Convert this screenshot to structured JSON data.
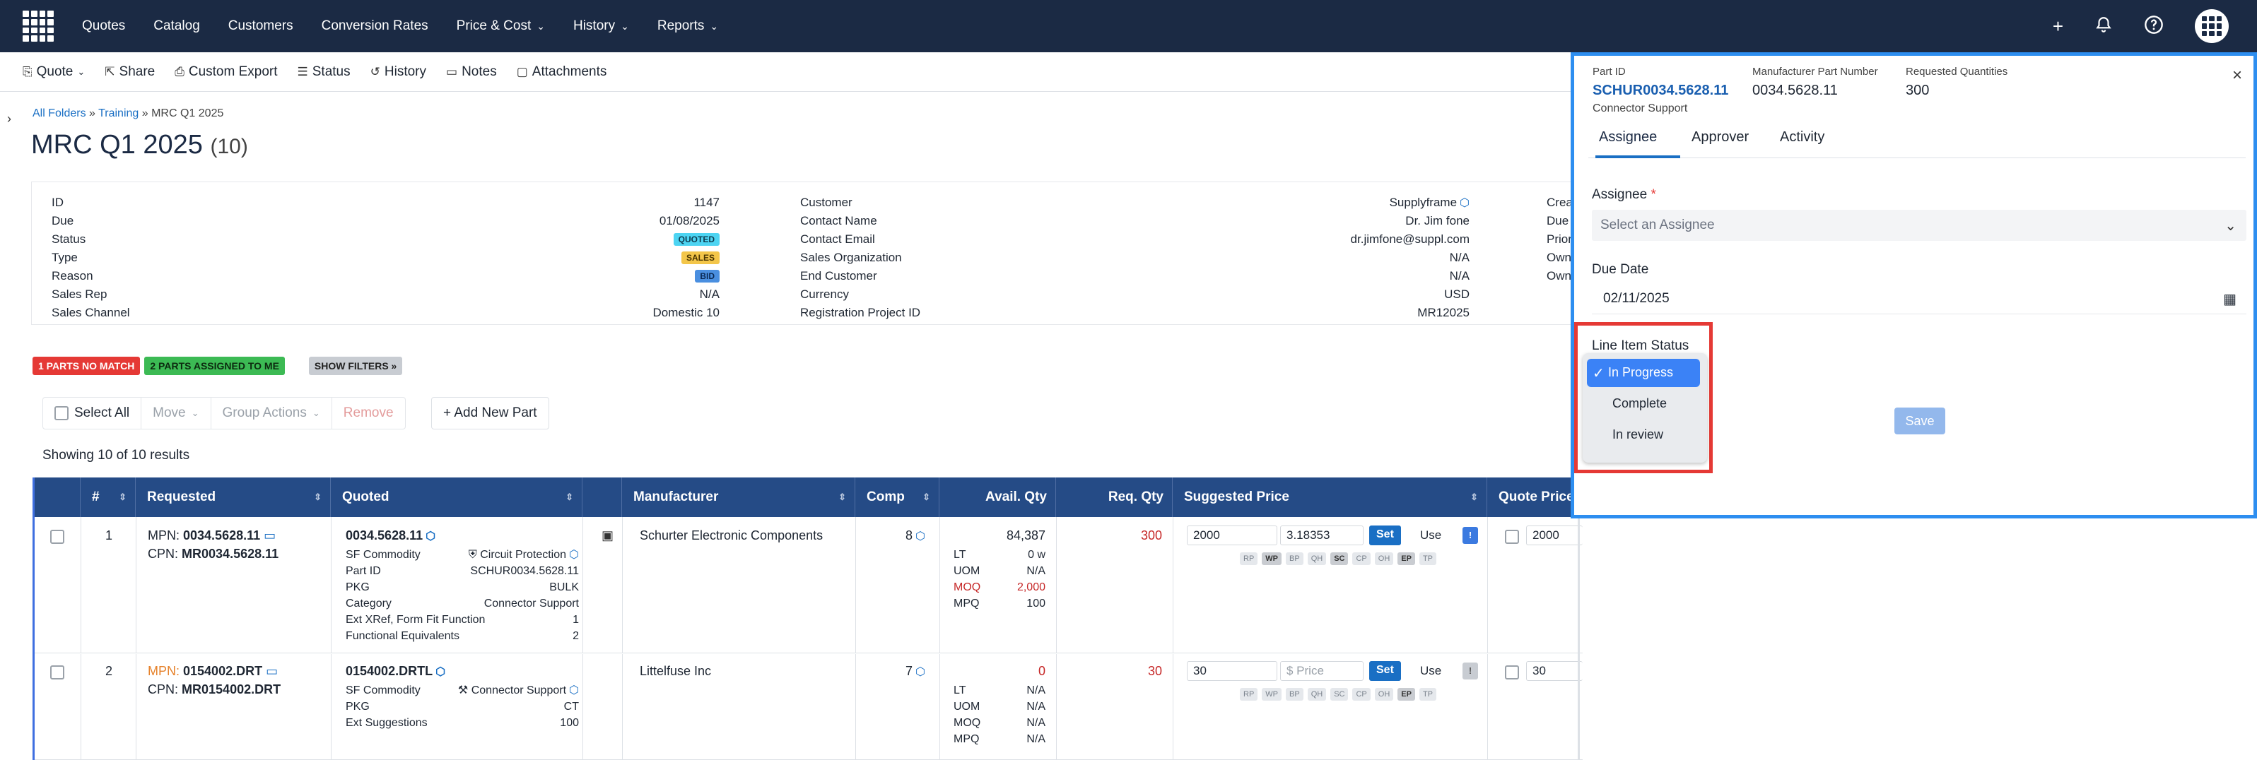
{
  "topnav": {
    "items": [
      "Quotes",
      "Catalog",
      "Customers",
      "Conversion Rates",
      "Price & Cost",
      "History",
      "Reports"
    ],
    "dropdown_flags": [
      false,
      false,
      false,
      false,
      true,
      true,
      true
    ],
    "icons": [
      "plus-icon",
      "bell-icon",
      "help-icon",
      "apps-icon"
    ]
  },
  "toolbar": {
    "items": [
      "Quote",
      "Share",
      "Custom Export",
      "Status",
      "History",
      "Notes",
      "Attachments"
    ]
  },
  "breadcrumb": {
    "items": [
      "All Folders",
      "Training",
      "MRC Q1 2025"
    ]
  },
  "quote": {
    "title": "MRC Q1 2025",
    "count": "(10)"
  },
  "details": {
    "col1": [
      {
        "label": "ID",
        "value": "1147"
      },
      {
        "label": "Due",
        "value": "01/08/2025"
      },
      {
        "label": "Status",
        "value": "QUOTED"
      },
      {
        "label": "Type",
        "value": "SALES"
      },
      {
        "label": "Reason",
        "value": "BID"
      },
      {
        "label": "Sales Rep",
        "value": "N/A"
      },
      {
        "label": "Sales Channel",
        "value": "Domestic 10"
      }
    ],
    "col2": [
      {
        "label": "Customer",
        "value": "Supplyframe"
      },
      {
        "label": "Contact Name",
        "value": "Dr. Jim fone"
      },
      {
        "label": "Contact Email",
        "value": "dr.jimfone@suppl.com"
      },
      {
        "label": "Sales Organization",
        "value": "N/A"
      },
      {
        "label": "End Customer",
        "value": "N/A"
      },
      {
        "label": "Currency",
        "value": "USD"
      },
      {
        "label": "Registration Project ID",
        "value": "MR12025"
      }
    ],
    "col3_partial": [
      "Creat",
      "Due T",
      "Priori",
      "Owne",
      "Owne"
    ]
  },
  "filters": {
    "no_match": "1 PARTS NO MATCH",
    "assigned": "2 PARTS ASSIGNED TO ME",
    "show": "SHOW FILTERS »"
  },
  "actions": {
    "select_all": "Select All",
    "move": "Move",
    "group_actions": "Group Actions",
    "remove": "Remove",
    "add_part": "+ Add New Part"
  },
  "results_text": "Showing 10 of 10 results",
  "grid": {
    "headers": [
      "#",
      "Requested",
      "Quoted",
      "Manufacturer",
      "Comp",
      "Avail. Qty",
      "Req. Qty",
      "Suggested Price",
      "Quote Price"
    ],
    "rows": [
      {
        "num": "1",
        "mpn_label": "MPN:",
        "mpn": "0034.5628.11",
        "cpn_label": "CPN:",
        "cpn": "MR0034.5628.11",
        "quoted": "0034.5628.11",
        "quoted_attrs": [
          {
            "k": "SF Commodity",
            "v": "Circuit Protection"
          },
          {
            "k": "Part ID",
            "v": "SCHUR0034.5628.11"
          },
          {
            "k": "PKG",
            "v": "BULK"
          },
          {
            "k": "Category",
            "v": "Connector Support"
          },
          {
            "k": "Ext XRef, Form Fit Function",
            "v": "1"
          },
          {
            "k": "Functional Equivalents",
            "v": "2"
          }
        ],
        "manufacturer": "Schurter Electronic Components",
        "comp": "8",
        "avail": "84,387",
        "avail_attrs": [
          {
            "k": "LT",
            "v": "0 w"
          },
          {
            "k": "UOM",
            "v": "N/A"
          },
          {
            "k": "MOQ",
            "v": "2,000"
          },
          {
            "k": "MPQ",
            "v": "100"
          }
        ],
        "req_qty": "300",
        "price_input": "2000",
        "price_calc": "3.18353",
        "set": "Set",
        "use": "Use",
        "info": "!",
        "tags": [
          "RP",
          "WP",
          "BP",
          "QH",
          "SC",
          "CP",
          "OH",
          "EP",
          "TP"
        ],
        "quote_price": "2000"
      },
      {
        "num": "2",
        "mpn_label": "MPN:",
        "mpn": "0154002.DRT",
        "cpn_label": "CPN:",
        "cpn": "MR0154002.DRT",
        "quoted": "0154002.DRTL",
        "quoted_attrs": [
          {
            "k": "SF Commodity",
            "v": "Connector Support"
          },
          {
            "k": "PKG",
            "v": "CT"
          },
          {
            "k": "Ext Suggestions",
            "v": "100"
          }
        ],
        "manufacturer": "Littelfuse Inc",
        "comp": "7",
        "avail": "0",
        "avail_attrs": [
          {
            "k": "LT",
            "v": "N/A"
          },
          {
            "k": "UOM",
            "v": "N/A"
          },
          {
            "k": "MOQ",
            "v": "N/A"
          },
          {
            "k": "MPQ",
            "v": "N/A"
          }
        ],
        "req_qty": "30",
        "price_input": "30",
        "price_placeholder": "$ Price",
        "set": "Set",
        "use": "Use",
        "info": "!",
        "tags": [
          "RP",
          "WP",
          "BP",
          "QH",
          "SC",
          "CP",
          "OH",
          "EP",
          "TP"
        ],
        "quote_price": "30"
      }
    ]
  },
  "panel": {
    "part_id_label": "Part ID",
    "part_id": "SCHUR0034.5628.11",
    "part_category": "Connector Support",
    "mpn_label": "Manufacturer Part Number",
    "mpn": "0034.5628.11",
    "req_label": "Requested Quantities",
    "req": "300",
    "close": "×",
    "tabs": [
      "Assignee",
      "Approver",
      "Activity"
    ],
    "assignee_label": "Assignee",
    "required_mark": "*",
    "assignee_placeholder": "Select an Assignee",
    "due_label": "Due Date",
    "due_value": "02/11/2025",
    "status_label": "Line Item Status",
    "status_options": [
      "In Progress",
      "Complete",
      "In review"
    ],
    "selected_status": "In Progress",
    "save": "Save"
  },
  "colors": {
    "nav_bg": "#1b2a44",
    "grid_header": "#254b86",
    "accent": "#1a6fc4",
    "highlight_blue": "#2d8ef0",
    "highlight_red": "#e53935"
  }
}
